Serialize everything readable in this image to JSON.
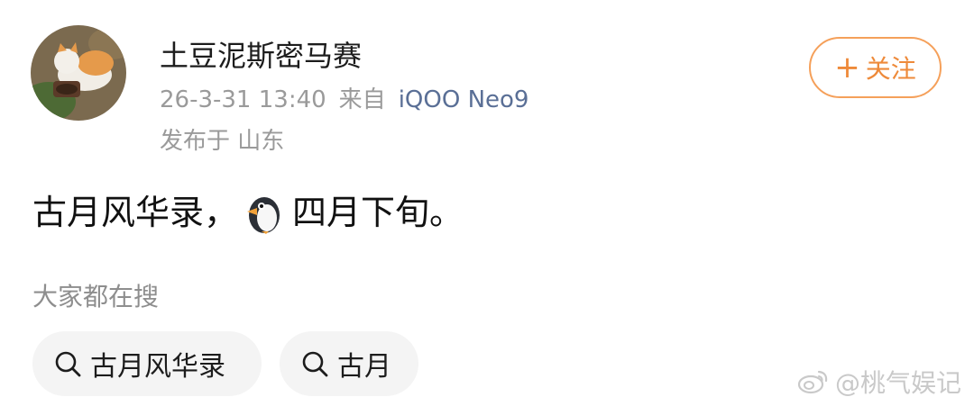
{
  "header": {
    "username": "土豆泥斯密马赛",
    "post_time": "26-3-31 13:40",
    "from_label": "来自",
    "device": "iQOO Neo9",
    "location": "发布于 山东"
  },
  "follow_button": {
    "plus": "+",
    "label": "关注"
  },
  "post": {
    "text_before_emoji": "古月风华录，",
    "emoji": "penguin-icon",
    "text_after_emoji": "四月下旬。"
  },
  "search_section": {
    "heading": "大家都在搜",
    "chips": [
      {
        "label": "古月风华录",
        "icon": "search-icon"
      },
      {
        "label": "古月",
        "icon": "search-icon"
      }
    ]
  },
  "watermark": {
    "text": "@桃气娱记",
    "icon": "weibo-logo"
  },
  "colors": {
    "accent": "#ee8a3a",
    "device_link": "#5a6f96",
    "meta_gray": "#9a9a9a",
    "chip_bg": "#f4f4f4"
  }
}
